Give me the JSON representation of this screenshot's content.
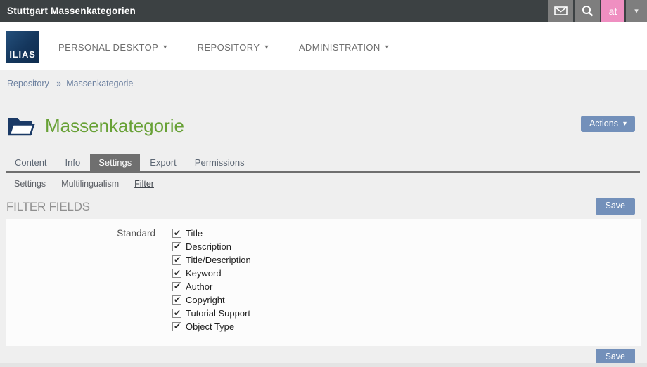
{
  "topbar": {
    "title": "Stuttgart Massenkategorien",
    "avatar_label": "at"
  },
  "navbar": {
    "logo_text": "ILIAS",
    "menus": [
      {
        "label": "PERSONAL DESKTOP"
      },
      {
        "label": "REPOSITORY"
      },
      {
        "label": "ADMINISTRATION"
      }
    ]
  },
  "breadcrumb": {
    "items": [
      {
        "label": "Repository",
        "sep": "»"
      },
      {
        "label": "Massenkategorie",
        "sep": ""
      }
    ]
  },
  "page": {
    "title": "Massenkategorie",
    "actions_label": "Actions"
  },
  "tabs": [
    {
      "label": "Content",
      "active": false
    },
    {
      "label": "Info",
      "active": false
    },
    {
      "label": "Settings",
      "active": true
    },
    {
      "label": "Export",
      "active": false
    },
    {
      "label": "Permissions",
      "active": false
    }
  ],
  "subtabs": [
    {
      "label": "Settings",
      "active": false
    },
    {
      "label": "Multilingualism",
      "active": false
    },
    {
      "label": "Filter",
      "active": true
    }
  ],
  "section": {
    "heading": "FILTER FIELDS",
    "save_label": "Save"
  },
  "form": {
    "label": "Standard",
    "options": [
      {
        "label": "Title",
        "checked": true
      },
      {
        "label": "Description",
        "checked": true
      },
      {
        "label": "Title/Description",
        "checked": true
      },
      {
        "label": "Keyword",
        "checked": true
      },
      {
        "label": "Author",
        "checked": true
      },
      {
        "label": "Copyright",
        "checked": true
      },
      {
        "label": "Tutorial Support",
        "checked": true
      },
      {
        "label": "Object Type",
        "checked": true
      }
    ]
  },
  "ui": {
    "caret": "▾",
    "check_glyph": "✔"
  },
  "colors": {
    "topbar_bg": "#3c4143",
    "topbar_segment": "#7e7e7e",
    "avatar_pink": "#ef8fc1",
    "logo_navy": "#14365c",
    "title_green": "#68a136",
    "button_blue": "#7390ba",
    "active_tab_gray": "#6f6f6f",
    "breadcrumb_blue": "#6d81a0",
    "content_bg": "#efefef"
  }
}
